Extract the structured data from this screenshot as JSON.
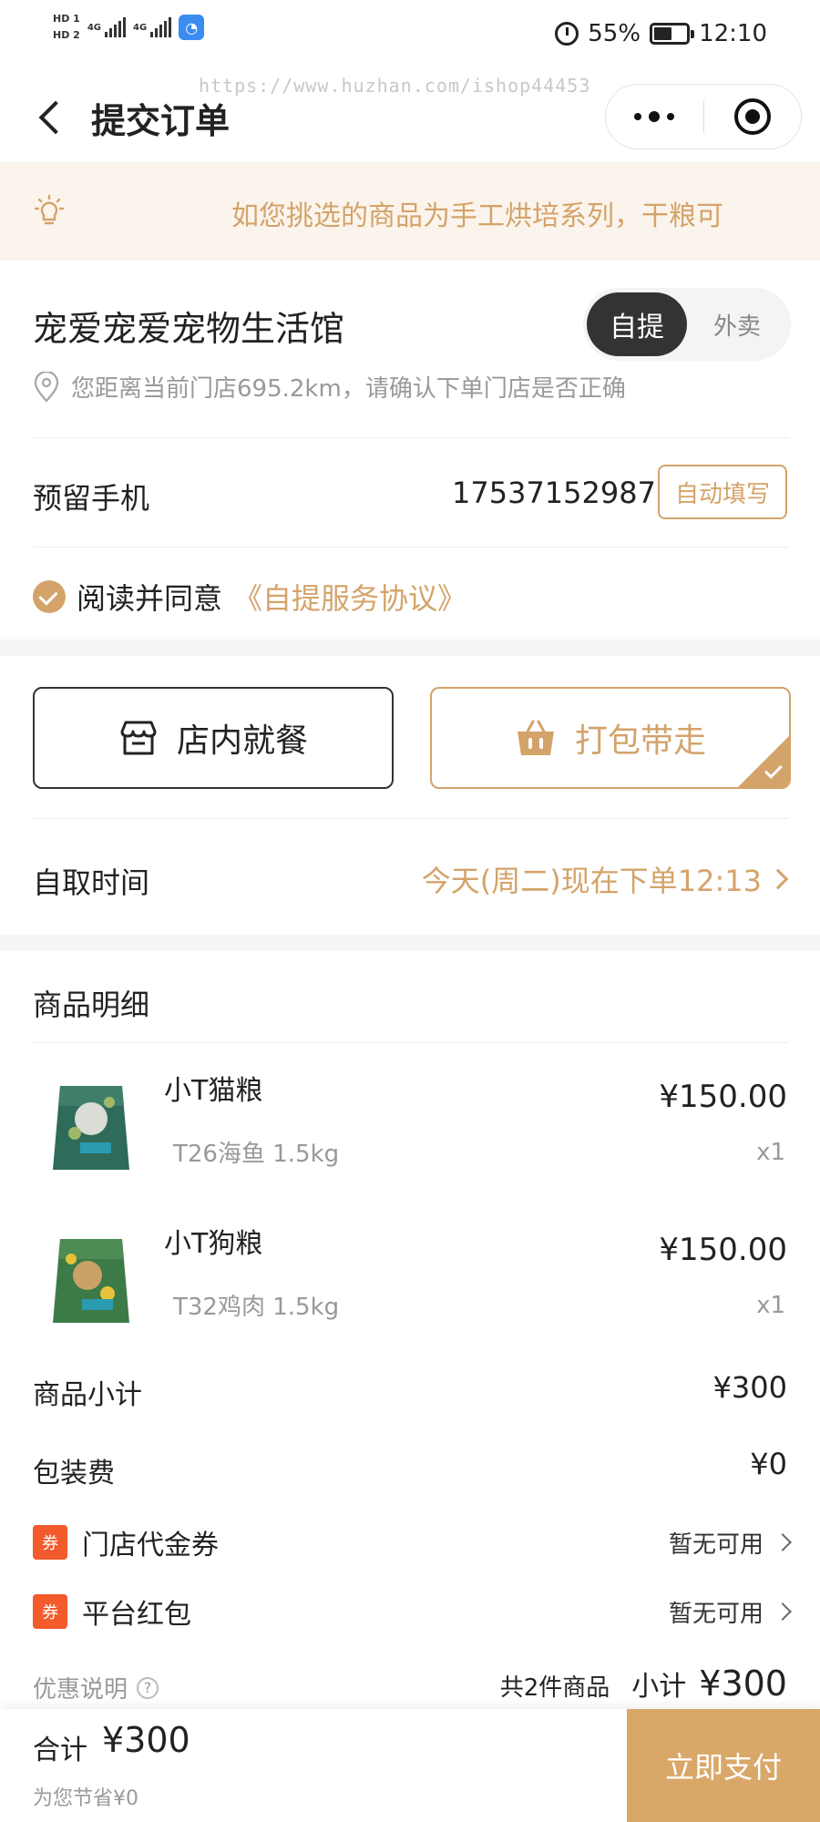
{
  "status_bar": {
    "sim1": "HD 1",
    "sim2": "HD 2",
    "net1": "4G",
    "net2": "4G",
    "battery": "55%",
    "battery_level": 0.55,
    "time": "12:10"
  },
  "nav": {
    "title": "提交订单",
    "watermark": "https://www.huzhan.com/ishop44453"
  },
  "notice": {
    "text": "如您挑选的商品为手工烘培系列，干粮可"
  },
  "store": {
    "name": "宠爱宠爱宠物生活馆",
    "mode_selected": "自提",
    "mode_other": "外卖",
    "distance_note": "您距离当前门店695.2km，请确认下单门店是否正确"
  },
  "phone": {
    "label": "预留手机",
    "value": "17537152987",
    "autofill_label": "自动填写"
  },
  "agreement": {
    "prefix": "阅读并同意",
    "link": "《自提服务协议》"
  },
  "dine_options": {
    "dine_in": "店内就餐",
    "take_away": "打包带走",
    "selected": "打包带走"
  },
  "pickup": {
    "label": "自取时间",
    "value": "今天(周二)现在下单12:13"
  },
  "goods": {
    "title": "商品明细",
    "items": [
      {
        "name": "小T猫粮",
        "spec": "T26海鱼 1.5kg",
        "price": "¥150.00",
        "qty": "x1"
      },
      {
        "name": "小T狗粮",
        "spec": "T32鸡肉 1.5kg",
        "price": "¥150.00",
        "qty": "x1"
      }
    ]
  },
  "fees": {
    "subtotal_label": "商品小计",
    "subtotal_value": "¥300",
    "packing_label": "包装费",
    "packing_value": "¥0"
  },
  "coupons": [
    {
      "tag": "券",
      "name": "门店代金券",
      "status": "暂无可用"
    },
    {
      "tag": "券",
      "name": "平台红包",
      "status": "暂无可用"
    }
  ],
  "promo": {
    "label": "优惠说明",
    "icon": "?",
    "count": "共2件商品",
    "sub_label": "小计",
    "sub_amount": "¥300"
  },
  "footer": {
    "total_label": "合计",
    "total_amount": "¥300",
    "saved": "为您节省¥0",
    "pay_label": "立即支付"
  },
  "colors": {
    "accent": "#d4a36a",
    "notice_bg": "#fbf4ec",
    "coupon_tag": "#f35a2c",
    "pay_button": "#d9a869"
  }
}
